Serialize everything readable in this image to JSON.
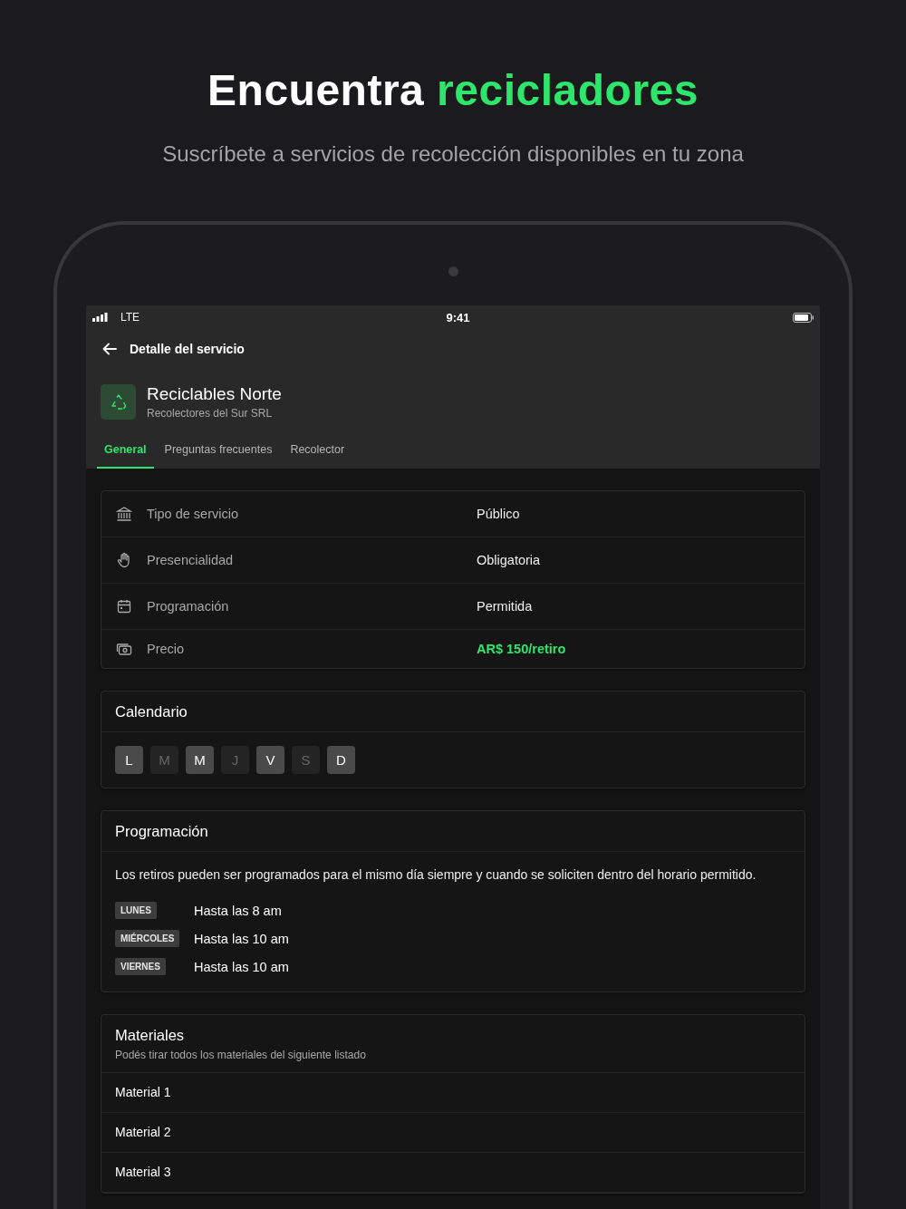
{
  "headline": {
    "lead": "Encuentra",
    "highlight": "recicladores"
  },
  "subtitle": "Suscríbete a servicios de recolección disponibles en tu zona",
  "status_bar": {
    "network": "LTE",
    "time": "9:41"
  },
  "app_bar": {
    "title": "Detalle del servicio"
  },
  "service": {
    "name": "Reciclables Norte",
    "company": "Recolectores del Sur SRL"
  },
  "tabs": [
    {
      "label": "General",
      "selected": true
    },
    {
      "label": "Preguntas frecuentes",
      "selected": false
    },
    {
      "label": "Recolector",
      "selected": false
    }
  ],
  "details": [
    {
      "label": "Tipo de servicio",
      "value": "Público",
      "highlight": false
    },
    {
      "label": "Presencialidad",
      "value": "Obligatoria",
      "highlight": false
    },
    {
      "label": "Programación",
      "value": "Permitida",
      "highlight": false
    },
    {
      "label": "Precio",
      "value": "AR$ 150/retiro",
      "highlight": true
    }
  ],
  "calendar": {
    "title": "Calendario",
    "days": [
      {
        "label": "L",
        "selected": true
      },
      {
        "label": "M",
        "selected": false
      },
      {
        "label": "M",
        "selected": true
      },
      {
        "label": "J",
        "selected": false
      },
      {
        "label": "V",
        "selected": true
      },
      {
        "label": "S",
        "selected": false
      },
      {
        "label": "D",
        "selected": true
      }
    ]
  },
  "scheduling": {
    "title": "Programación",
    "description": "Los retiros pueden ser programados para el mismo día siempre y cuando se soliciten dentro del horario permitido.",
    "slots": [
      {
        "day": "LUNES",
        "limit": "Hasta las 8 am"
      },
      {
        "day": "MIÉRCOLES",
        "limit": "Hasta las 10 am"
      },
      {
        "day": "VIERNES",
        "limit": "Hasta las 10 am"
      }
    ]
  },
  "materials": {
    "title": "Materiales",
    "subtitle": "Podés tirar todos los materiales del siguiente listado",
    "items": [
      "Material 1",
      "Material 2",
      "Material 3"
    ]
  }
}
